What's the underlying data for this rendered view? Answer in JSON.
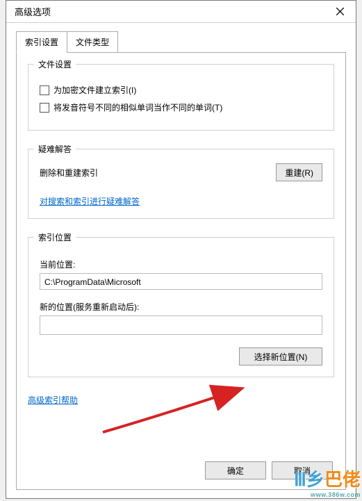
{
  "titlebar": {
    "title": "高级选项"
  },
  "tabs": {
    "index": "索引设置",
    "filetype": "文件类型"
  },
  "file_settings": {
    "legend": "文件设置",
    "encrypt_label": "为加密文件建立索引(I)",
    "diacritic_label": "将发音符号不同的相似单词当作不同的单词(T)"
  },
  "troubleshoot": {
    "legend": "疑难解答",
    "delete_label": "删除和重建索引",
    "rebuild_button": "重建(R)",
    "link": "对搜索和索引进行疑难解答"
  },
  "index_location": {
    "legend": "索引位置",
    "current_label": "当前位置:",
    "current_path": "C:\\ProgramData\\Microsoft",
    "new_label": "新的位置(服务重新启动后):",
    "new_value": "",
    "select_button": "选择新位置(N)"
  },
  "help_link": "高级索引帮助",
  "buttons": {
    "ok": "确定",
    "cancel": "取消"
  },
  "watermark": {
    "b1": "Ⅲ乡",
    "b2": "巴佬",
    "url": "www.386w.com"
  }
}
